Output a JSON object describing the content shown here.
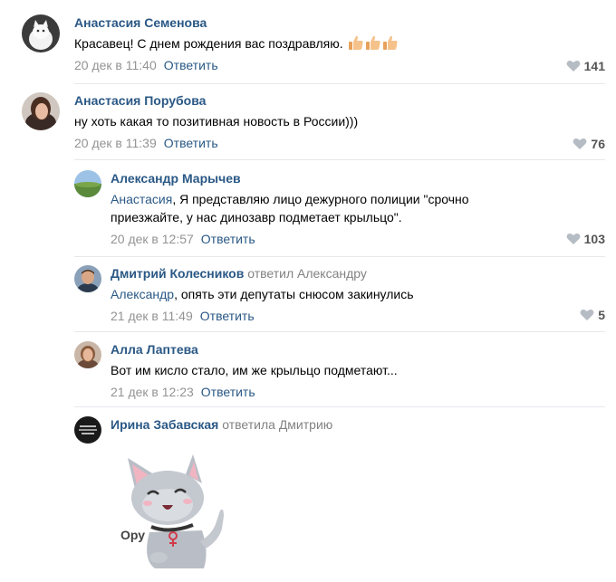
{
  "comments": [
    {
      "author": "Анастасия Семенова",
      "text": "Красавец! С днем рождения вас поздравляю.",
      "emoji": "thumbs-up x3",
      "date": "20 дек в 11:40",
      "reply_label": "Ответить",
      "likes": "141"
    },
    {
      "author": "Анастасия Порубова",
      "text": "ну хоть какая то позитивная новость в России)))",
      "date": "20 дек в 11:39",
      "reply_label": "Ответить",
      "likes": "76"
    }
  ],
  "replies": [
    {
      "author": "Александр Марычев",
      "mention": "Анастасия",
      "text_line1": ", Я представляю лицо дежурного полиции \"срочно",
      "text_line2": "приезжайте, у нас динозавр подметает крыльцо\".",
      "date": "20 дек в 12:57",
      "reply_label": "Ответить",
      "likes": "103"
    },
    {
      "author": "Дмитрий Колесников",
      "replied_to": "ответил Александру",
      "mention": "Александр",
      "text": ", опять эти депутаты снюсом закинулись",
      "date": "21 дек в 11:49",
      "reply_label": "Ответить",
      "likes": "5"
    },
    {
      "author": "Алла Лаптева",
      "text": "Вот им кисло стало, им же крыльцо подметают...",
      "date": "21 дек в 12:23",
      "reply_label": "Ответить"
    },
    {
      "author": "Ирина Забавская",
      "replied_to": "ответила Дмитрию",
      "sticker_caption": "Ору"
    }
  ],
  "colors": {
    "link": "#2a5885",
    "meta": "#939393",
    "divider": "#e7e8ec"
  }
}
